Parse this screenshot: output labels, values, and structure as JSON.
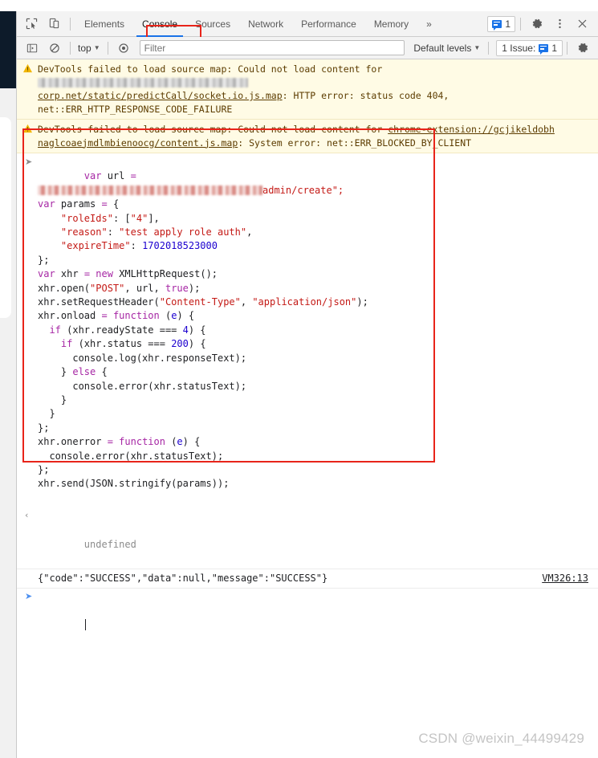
{
  "window": {
    "tabbar": {
      "icons": [
        {
          "name": "inspect-element-icon",
          "glyph": "inspect"
        },
        {
          "name": "device-toolbar-icon",
          "glyph": "device"
        }
      ],
      "tabs": [
        {
          "label": "Elements",
          "active": false
        },
        {
          "label": "Console",
          "active": true
        },
        {
          "label": "Sources",
          "active": false
        },
        {
          "label": "Network",
          "active": false
        },
        {
          "label": "Performance",
          "active": false
        },
        {
          "label": "Memory",
          "active": false
        }
      ],
      "more_label": "»",
      "message_count": "1",
      "settings_label": "⚙",
      "more_options_label": "⋮",
      "close_label": "✕"
    },
    "filterbar": {
      "sidebar_toggle_name": "console-sidebar-icon",
      "clear_label": "clear-console-icon",
      "context": "top",
      "eye_label": "live-expressions-icon",
      "filter_value": "",
      "filter_placeholder": "Filter",
      "levels": "Default levels",
      "issues": "1 Issue:",
      "issues_count": "1",
      "settings_label": "⚙"
    }
  },
  "warnings": [
    {
      "icon": "warning-triangle-icon",
      "seg1": "DevTools failed to load source map: Could not load content for ",
      "redacted": true,
      "link": "corp.net/static/predictCall/socket.io.js.map",
      "seg2": ": HTTP error: status code 404,",
      "seg3": "net::ERR_HTTP_RESPONSE_CODE_FAILURE"
    },
    {
      "icon": "warning-triangle-icon",
      "seg1": "DevTools failed to load source map: Could not load content for ",
      "redacted": false,
      "link": "chrome-extension://gcjikeldobh",
      "link2": "naglcoaejmdlmbienoocg/content.js.map",
      "seg2": ": System error: net::ERR_BLOCKED_BY_CLIENT"
    }
  ],
  "console": {
    "input_code": [
      {
        "id": "l1",
        "pre": "var url = ",
        "redacted": true,
        "post": "admin/create\";"
      },
      {
        "id": "l2",
        "text": "var params = {"
      },
      {
        "id": "l3",
        "text": "    \"roleIds\": [\"4\"],"
      },
      {
        "id": "l4",
        "text": "    \"reason\": \"test apply role auth\","
      },
      {
        "id": "l5",
        "text": "    \"expireTime\": 1702018523000"
      },
      {
        "id": "l6",
        "text": "};"
      },
      {
        "id": "l7",
        "text": "var xhr = new XMLHttpRequest();"
      },
      {
        "id": "l8",
        "text": "xhr.open(\"POST\", url, true);"
      },
      {
        "id": "l9",
        "text": "xhr.setRequestHeader(\"Content-Type\", \"application/json\");"
      },
      {
        "id": "l10",
        "text": "xhr.onload = function (e) {"
      },
      {
        "id": "l11",
        "text": "  if (xhr.readyState === 4) {"
      },
      {
        "id": "l12",
        "text": "    if (xhr.status === 200) {"
      },
      {
        "id": "l13",
        "text": "      console.log(xhr.responseText);"
      },
      {
        "id": "l14",
        "text": "    } else {"
      },
      {
        "id": "l15",
        "text": "      console.error(xhr.statusText);"
      },
      {
        "id": "l16",
        "text": "    }"
      },
      {
        "id": "l17",
        "text": "  }"
      },
      {
        "id": "l18",
        "text": "};"
      },
      {
        "id": "l19",
        "text": "xhr.onerror = function (e) {"
      },
      {
        "id": "l20",
        "text": "  console.error(xhr.statusText);"
      },
      {
        "id": "l21",
        "text": "};"
      },
      {
        "id": "l22",
        "text": "xhr.send(JSON.stringify(params));"
      }
    ],
    "return_value": "undefined",
    "log_output": "{\"code\":\"SUCCESS\",\"data\":null,\"message\":\"SUCCESS\"}",
    "log_source": "VM326:13",
    "prompt_value": ""
  },
  "watermark": "CSDN @weixin_44499429",
  "colors": {
    "accent": "#1a73e8",
    "annotation": "#e8241a",
    "warning_bg": "#fffbe5",
    "string": "#c41a16",
    "number": "#1c00cf",
    "keyword": "#a626a4"
  }
}
